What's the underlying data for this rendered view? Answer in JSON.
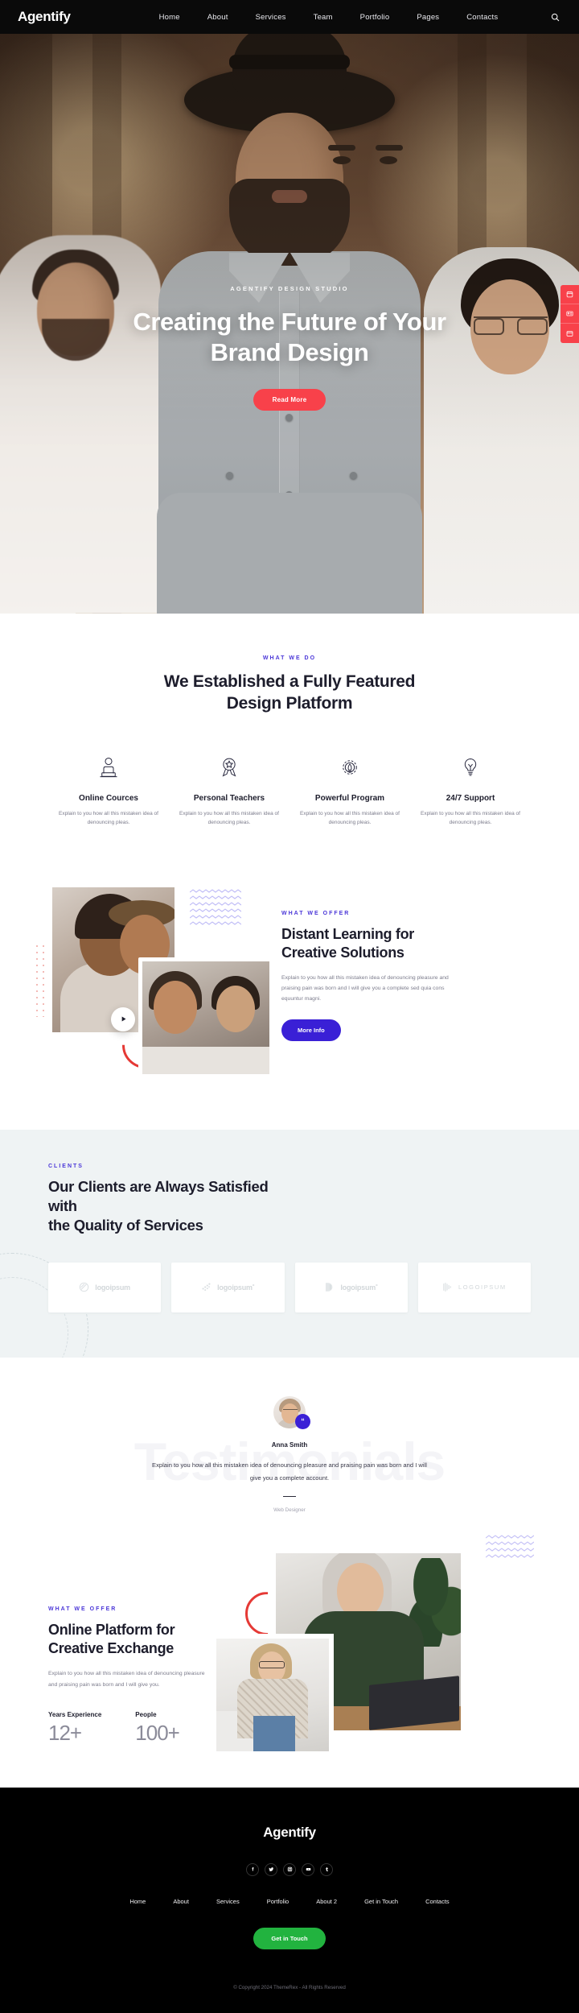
{
  "brand": "Agentify",
  "header": {
    "nav": [
      {
        "label": "Home"
      },
      {
        "label": "About"
      },
      {
        "label": "Services"
      },
      {
        "label": "Team"
      },
      {
        "label": "Portfolio"
      },
      {
        "label": "Pages"
      },
      {
        "label": "Contacts"
      }
    ],
    "search_icon": "search-icon"
  },
  "hero": {
    "eyebrow": "AGENTIFY DESIGN STUDIO",
    "title_line1": "Creating the Future of Your",
    "title_line2": "Brand Design",
    "cta": "Read More",
    "cta_color": "#f8414a",
    "side_widget": {
      "color": "#f8414a",
      "items": [
        "calendar-icon",
        "id-card-icon",
        "window-icon"
      ]
    }
  },
  "what_we_do": {
    "eyebrow": "WHAT WE DO",
    "eyebrow_color": "#4b37d8",
    "title_line1": "We Established a Fully Featured",
    "title_line2": "Design Platform",
    "features": [
      {
        "icon": "person-laptop-icon",
        "title": "Online Cources",
        "text": "Explain to you how all this mistaken idea of denouncing pleas."
      },
      {
        "icon": "award-ribbon-icon",
        "title": "Personal Teachers",
        "text": "Explain to you how all this mistaken idea of denouncing pleas."
      },
      {
        "icon": "gear-rocket-icon",
        "title": "Powerful Program",
        "text": "Explain to you how all this mistaken idea of denouncing pleas."
      },
      {
        "icon": "lightbulb-icon",
        "title": "24/7 Support",
        "text": "Explain to you how all this mistaken idea of denouncing pleas."
      }
    ]
  },
  "distant_learning": {
    "eyebrow": "WHAT WE OFFER",
    "title_line1": "Distant Learning for",
    "title_line2": "Creative Solutions",
    "text": "Explain to you how all this mistaken idea of denouncing pleasure and praising pain was born and I will give you a complete sed quia cons equuntur magni.",
    "cta": "More Info",
    "cta_color": "#3a20d6",
    "play_icon": "play-icon"
  },
  "clients": {
    "eyebrow": "CLIENTS",
    "title_line1": "Our Clients are Always Satisfied with",
    "title_line2": "the Quality of Services",
    "logos": [
      {
        "name": "logoipsum",
        "mark": "circle-swirl-icon"
      },
      {
        "name": "logoipsum˚",
        "mark": "dots-diagonal-icon"
      },
      {
        "name": "logoipsum˚",
        "mark": "split-shape-icon"
      },
      {
        "name": "LOGOIPSUM",
        "mark": "bars-icon"
      }
    ]
  },
  "testimonials": {
    "ghost_text": "Testimonials",
    "name": "Anna Smith",
    "quote": "Explain to you how all this mistaken idea of denouncing pleasure and praising pain was born and I will give you a complete account.",
    "role": "Web Designer",
    "badge_icon": "quote-icon",
    "badge_color": "#3a20d6"
  },
  "platform": {
    "eyebrow": "WHAT WE OFFER",
    "title_line1": "Online Platform for",
    "title_line2": "Creative Exchange",
    "text": "Explain to you how all this mistaken idea of denouncing pleasure and praising pain was born and I will give you.",
    "stats": [
      {
        "label": "Years Experience",
        "value": "12+"
      },
      {
        "label": "People",
        "value": "100+"
      }
    ]
  },
  "footer": {
    "brand": "Agentify",
    "socials": [
      {
        "name": "facebook-icon",
        "glyph": "f"
      },
      {
        "name": "twitter-icon",
        "glyph": "t"
      },
      {
        "name": "instagram-icon",
        "glyph": "i"
      },
      {
        "name": "youtube-icon",
        "glyph": "y"
      },
      {
        "name": "tumblr-icon",
        "glyph": "t"
      }
    ],
    "nav": [
      {
        "label": "Home"
      },
      {
        "label": "About"
      },
      {
        "label": "Services"
      },
      {
        "label": "Portfolio"
      },
      {
        "label": "About 2"
      },
      {
        "label": "Get in Touch"
      },
      {
        "label": "Contacts"
      }
    ],
    "cta": "Get in Touch",
    "cta_color": "#22b33f",
    "copyright": "© Copyright 2024 ThemeRex - All Rights Reserved"
  }
}
